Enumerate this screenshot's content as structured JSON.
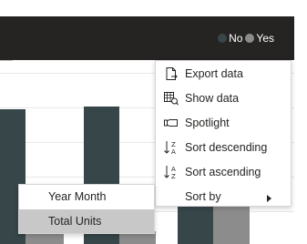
{
  "colors": {
    "header_bg": "#252423",
    "series_no": "#374649",
    "series_yes": "#8c8c8c",
    "menu_text": "#252423",
    "submenu_selected": "#c8c8c8"
  },
  "legend": {
    "items": [
      {
        "label": "No",
        "color": "#374649"
      },
      {
        "label": "Yes",
        "color": "#8c8c8c"
      }
    ]
  },
  "context_menu": {
    "items": [
      {
        "label": "Export data",
        "icon": "export-data-icon"
      },
      {
        "label": "Show data",
        "icon": "show-data-icon"
      },
      {
        "label": "Spotlight",
        "icon": "spotlight-icon"
      },
      {
        "label": "Sort descending",
        "icon": "sort-descending-icon"
      },
      {
        "label": "Sort ascending",
        "icon": "sort-ascending-icon"
      },
      {
        "label": "Sort by",
        "icon": "chevron-right-icon"
      }
    ]
  },
  "sort_by_submenu": {
    "items": [
      {
        "label": "Year Month",
        "selected": false
      },
      {
        "label": "Total Units",
        "selected": true
      }
    ]
  }
}
